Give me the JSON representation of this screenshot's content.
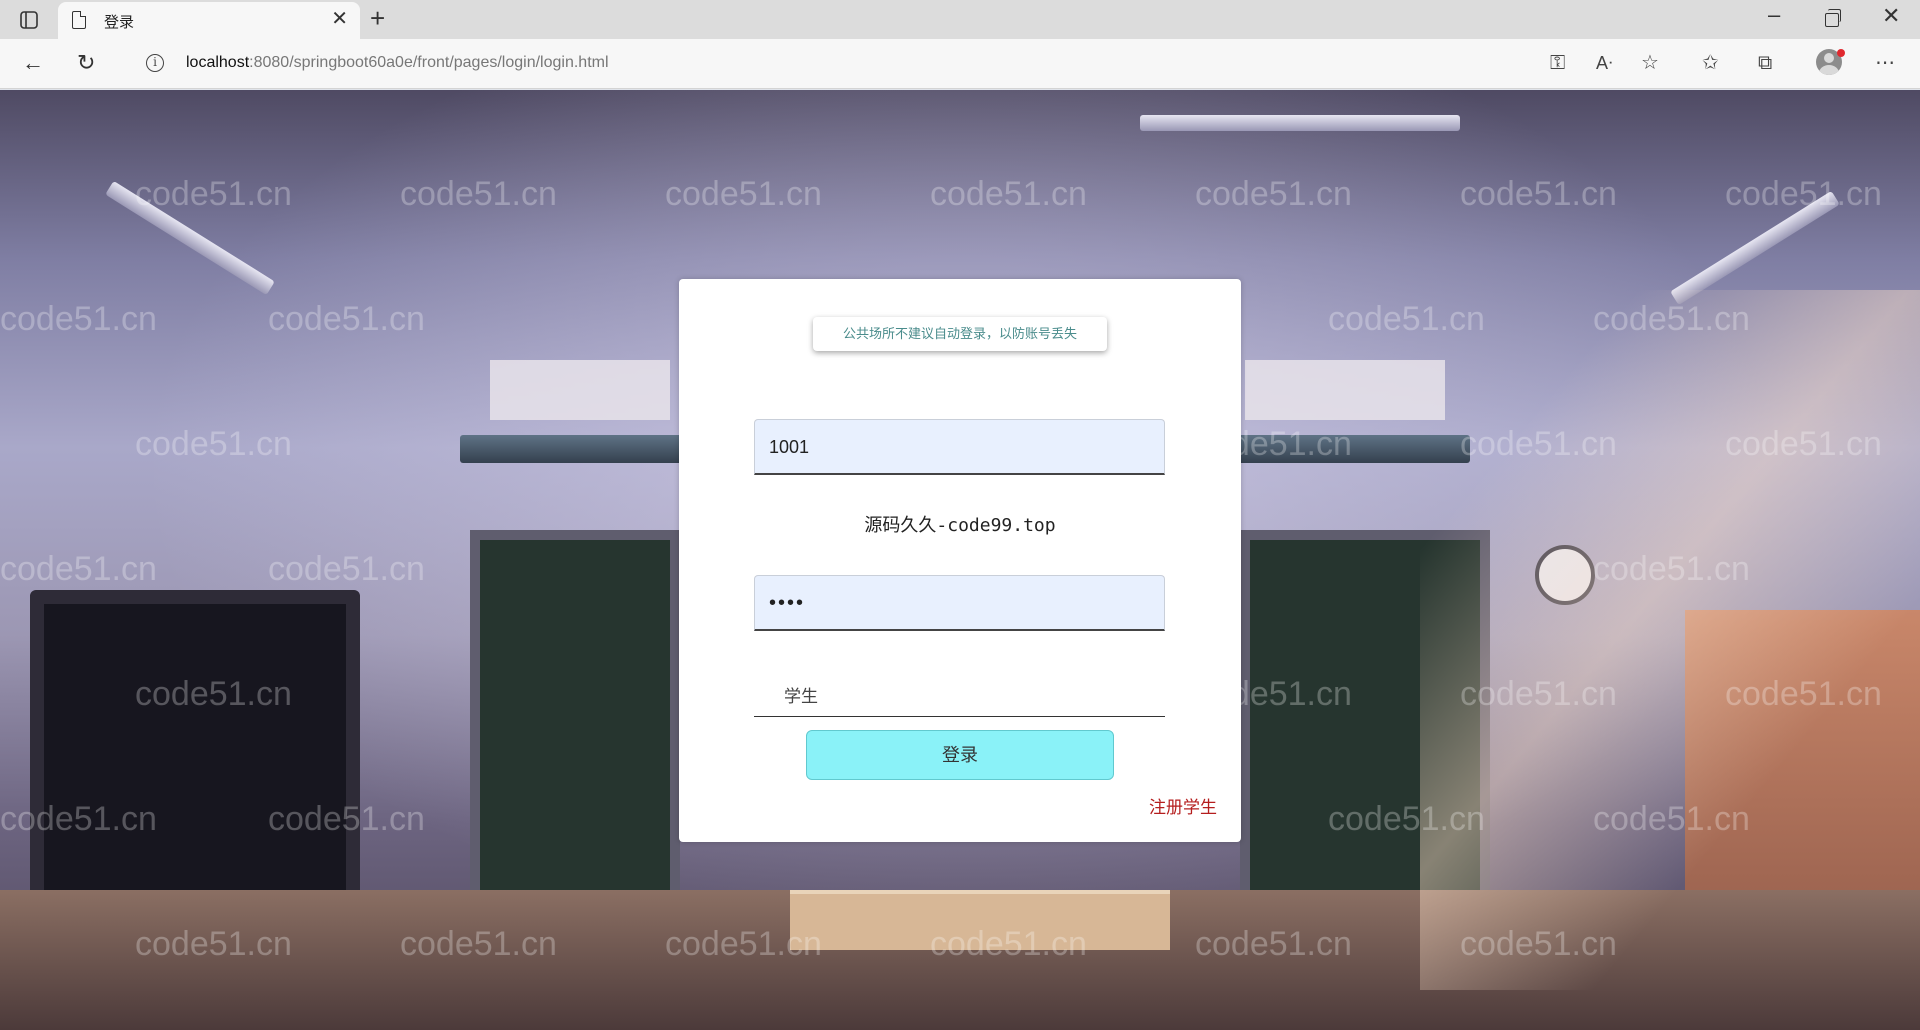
{
  "browser": {
    "tab_title": "登录",
    "url_host": "localhost",
    "url_path": ":8080/springboot60a0e/front/pages/login/login.html"
  },
  "watermark_text": "code51.cn",
  "login": {
    "tip": "公共场所不建议自动登录，以防账号丢失",
    "username_value": "1001",
    "brand_text": "源码久久-code99.top",
    "password_value": "••••",
    "role_value": "学生",
    "login_label": "登录",
    "register_label": "注册学生"
  },
  "colors": {
    "login_button": "#8af2f8",
    "register_link": "#b51e1e",
    "input_background": "#e8f0fe"
  }
}
